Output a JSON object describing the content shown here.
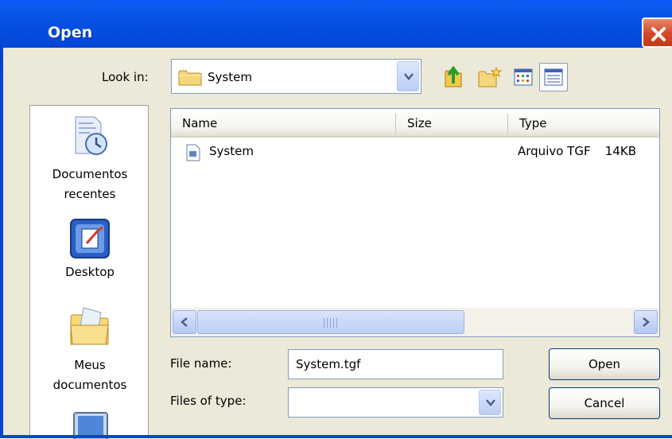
{
  "window": {
    "title": "Open",
    "close_label": "Close"
  },
  "lookin": {
    "label": "Look in:",
    "value": "System"
  },
  "toolbar": {
    "icons": [
      "up-one-level-icon",
      "new-folder-icon",
      "list-view-icon",
      "details-view-icon"
    ]
  },
  "places": [
    {
      "label": "Documentos recentes",
      "icon": "recent-documents-icon"
    },
    {
      "label": "Desktop",
      "icon": "desktop-icon"
    },
    {
      "label": "Meus documentos",
      "icon": "my-documents-icon"
    }
  ],
  "filelist": {
    "columns": [
      "Name",
      "Size",
      "Type"
    ],
    "rows": [
      {
        "name": "System",
        "size": "14KB",
        "type": "Arquivo TGF"
      }
    ]
  },
  "form": {
    "filename_label": "File name:",
    "filename_value": "System.tgf",
    "filetype_label": "Files of type:",
    "filetype_value": ""
  },
  "buttons": {
    "open": "Open",
    "cancel": "Cancel"
  },
  "colors": {
    "titlebar": "#0447d6",
    "dialog_bg": "#ece9d8",
    "close_button": "#d6492a"
  }
}
